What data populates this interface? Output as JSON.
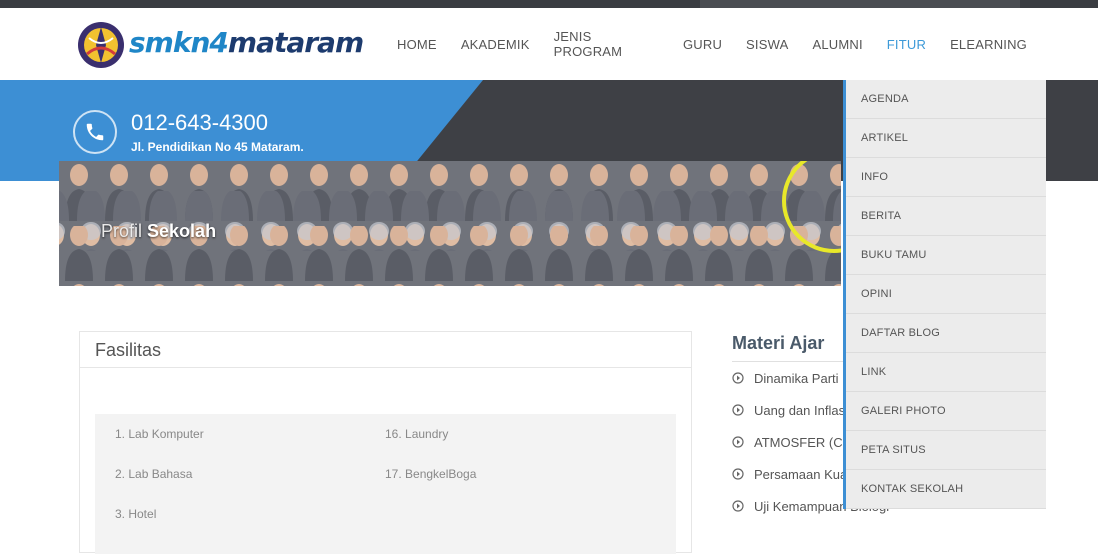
{
  "logo": {
    "text_a": "smkn",
    "text_b": "4",
    "text_c": "mataram"
  },
  "nav": {
    "items": [
      "HOME",
      "AKADEMIK",
      "JENIS PROGRAM",
      "GURU",
      "SISWA",
      "ALUMNI",
      "FITUR",
      "ELEARNING"
    ],
    "active": "FITUR"
  },
  "contact": {
    "icon": "phone-icon",
    "phone": "012-643-4300",
    "address": "Jl. Pendidikan No 45 Mataram."
  },
  "banner": {
    "title_light": "Profil",
    "title_bold": "Sekolah"
  },
  "fasilitas": {
    "title": "Fasilitas",
    "col1": [
      "1. Lab Komputer",
      "2. Lab Bahasa",
      "3. Hotel"
    ],
    "col2": [
      "16. Laundry",
      "17. BengkelBoga"
    ]
  },
  "materi": {
    "title": "Materi Ajar",
    "items": [
      "Dinamika Parti",
      "Uang dan Inflas",
      "ATMOSFER (Cu",
      "Persamaan Kua",
      "Uji Kemampuan Biologi"
    ]
  },
  "dropdown": {
    "items": [
      "AGENDA",
      "ARTIKEL",
      "INFO",
      "BERITA",
      "BUKU TAMU",
      "OPINI",
      "DAFTAR BLOG",
      "LINK",
      "GALERI PHOTO",
      "PETA SITUS",
      "KONTAK SEKOLAH"
    ]
  },
  "colors": {
    "brand_blue": "#3d8fd4",
    "active_nav": "#3d9ad8",
    "dark_band": "#3e4045"
  }
}
